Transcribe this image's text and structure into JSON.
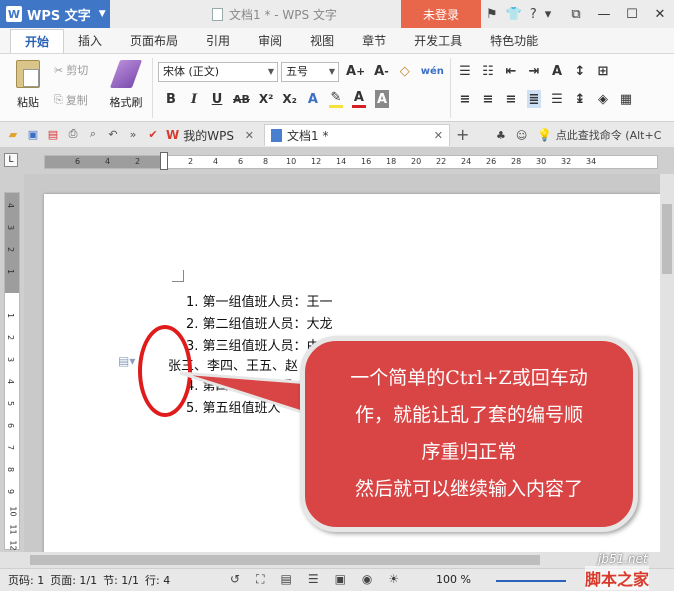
{
  "titlebar": {
    "app_name": "WPS 文字",
    "logo_letter": "W",
    "doc_title": "文档1 * - WPS 文字",
    "login": "未登录",
    "help": "?"
  },
  "ribbon_tabs": [
    "开始",
    "插入",
    "页面布局",
    "引用",
    "审阅",
    "视图",
    "章节",
    "开发工具",
    "特色功能"
  ],
  "ribbon": {
    "paste": "粘贴",
    "cut": "剪切",
    "copy": "复制",
    "format_painter": "格式刷",
    "font_name": "宋体 (正文)",
    "font_size": "五号",
    "bold": "B",
    "italic": "I",
    "underline": "U",
    "strike": "AB",
    "superscript": "X²",
    "subscript": "X₂"
  },
  "doc_tabs": {
    "tab1": "我的WPS",
    "tab2": "文档1 *",
    "search_hint": "点此查找命令 (Alt+C"
  },
  "ruler": {
    "h_ticks": [
      "6",
      "4",
      "2",
      "2",
      "4",
      "6",
      "8",
      "10",
      "12",
      "14",
      "16",
      "18",
      "20",
      "22",
      "24",
      "26",
      "28",
      "30",
      "32",
      "34"
    ],
    "v_ticks": [
      "4",
      "3",
      "2",
      "1",
      "1",
      "2",
      "3",
      "4",
      "5",
      "6",
      "7",
      "8",
      "9",
      "10",
      "11",
      "12"
    ]
  },
  "document": {
    "lines": [
      "1. 第一组值班人员：王一",
      "2. 第二组值班人员：大龙",
      "3. 第三组值班人员：由如下 4 名官兵组成",
      "张三、李四、王五、赵",
      "4. 第四组值班人员：",
      "5. 第五组值班人"
    ]
  },
  "callout": {
    "lines": [
      "一个简单的Ctrl+Z或回车动",
      "作，就能让乱了套的编号顺",
      "序重归正常",
      "然后就可以继续输入内容了"
    ]
  },
  "statusbar": {
    "page": "页码: 1",
    "pages": "页面: 1/1",
    "section": "节: 1/1",
    "row": "行: 4",
    "zoom": "100 %"
  },
  "watermark": {
    "url": "jb51.net",
    "site": "脚本之家"
  }
}
